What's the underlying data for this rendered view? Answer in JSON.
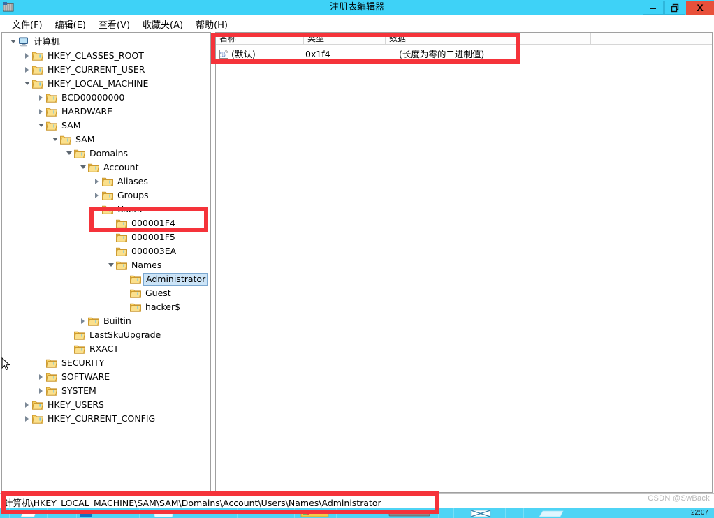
{
  "window": {
    "title": "注册表编辑器",
    "icon": "registry-editor-icon",
    "minimize_label": "—",
    "maximize_label": "❐",
    "close_label": "X"
  },
  "menubar": {
    "items": [
      {
        "label": "文件(F)",
        "name": "menu-file"
      },
      {
        "label": "编辑(E)",
        "name": "menu-edit"
      },
      {
        "label": "查看(V)",
        "name": "menu-view"
      },
      {
        "label": "收藏夹(A)",
        "name": "menu-favorites"
      },
      {
        "label": "帮助(H)",
        "name": "menu-help"
      }
    ]
  },
  "tree": {
    "root_label": "计算机",
    "nodes": [
      {
        "label": "计算机",
        "depth": 0,
        "state": "expanded",
        "icon": "computer-icon",
        "selected": false
      },
      {
        "label": "HKEY_CLASSES_ROOT",
        "depth": 1,
        "state": "collapsed",
        "icon": "folder-icon",
        "selected": false
      },
      {
        "label": "HKEY_CURRENT_USER",
        "depth": 1,
        "state": "collapsed",
        "icon": "folder-icon",
        "selected": false
      },
      {
        "label": "HKEY_LOCAL_MACHINE",
        "depth": 1,
        "state": "expanded",
        "icon": "folder-icon",
        "selected": false
      },
      {
        "label": "BCD00000000",
        "depth": 2,
        "state": "collapsed",
        "icon": "folder-icon",
        "selected": false
      },
      {
        "label": "HARDWARE",
        "depth": 2,
        "state": "collapsed",
        "icon": "folder-icon",
        "selected": false
      },
      {
        "label": "SAM",
        "depth": 2,
        "state": "expanded",
        "icon": "folder-icon",
        "selected": false
      },
      {
        "label": "SAM",
        "depth": 3,
        "state": "expanded",
        "icon": "folder-icon",
        "selected": false
      },
      {
        "label": "Domains",
        "depth": 4,
        "state": "expanded",
        "icon": "folder-icon",
        "selected": false
      },
      {
        "label": "Account",
        "depth": 5,
        "state": "expanded",
        "icon": "folder-icon",
        "selected": false
      },
      {
        "label": "Aliases",
        "depth": 6,
        "state": "collapsed",
        "icon": "folder-icon",
        "selected": false
      },
      {
        "label": "Groups",
        "depth": 6,
        "state": "collapsed",
        "icon": "folder-icon",
        "selected": false
      },
      {
        "label": "Users",
        "depth": 6,
        "state": "expanded",
        "icon": "folder-icon",
        "selected": false
      },
      {
        "label": "000001F4",
        "depth": 7,
        "state": "leaf",
        "icon": "folder-icon",
        "selected": false
      },
      {
        "label": "000001F5",
        "depth": 7,
        "state": "leaf",
        "icon": "folder-icon",
        "selected": false
      },
      {
        "label": "000003EA",
        "depth": 7,
        "state": "leaf",
        "icon": "folder-icon",
        "selected": false
      },
      {
        "label": "Names",
        "depth": 7,
        "state": "expanded",
        "icon": "folder-icon",
        "selected": false
      },
      {
        "label": "Administrator",
        "depth": 8,
        "state": "leaf",
        "icon": "folder-icon",
        "selected": true
      },
      {
        "label": "Guest",
        "depth": 8,
        "state": "leaf",
        "icon": "folder-icon",
        "selected": false
      },
      {
        "label": "hacker$",
        "depth": 8,
        "state": "leaf",
        "icon": "folder-icon",
        "selected": false
      },
      {
        "label": "Builtin",
        "depth": 5,
        "state": "collapsed",
        "icon": "folder-icon",
        "selected": false
      },
      {
        "label": "LastSkuUpgrade",
        "depth": 4,
        "state": "leaf",
        "icon": "folder-icon",
        "selected": false
      },
      {
        "label": "RXACT",
        "depth": 4,
        "state": "leaf",
        "icon": "folder-icon",
        "selected": false
      },
      {
        "label": "SECURITY",
        "depth": 2,
        "state": "leaf",
        "icon": "folder-icon",
        "selected": false
      },
      {
        "label": "SOFTWARE",
        "depth": 2,
        "state": "collapsed",
        "icon": "folder-icon",
        "selected": false
      },
      {
        "label": "SYSTEM",
        "depth": 2,
        "state": "collapsed",
        "icon": "folder-icon",
        "selected": false
      },
      {
        "label": "HKEY_USERS",
        "depth": 1,
        "state": "collapsed",
        "icon": "folder-icon",
        "selected": false
      },
      {
        "label": "HKEY_CURRENT_CONFIG",
        "depth": 1,
        "state": "collapsed",
        "icon": "folder-icon",
        "selected": false
      }
    ]
  },
  "value_list": {
    "columns": [
      "名称",
      "类型",
      "数据"
    ],
    "rows": [
      {
        "icon": "binary-value-icon",
        "name": "(默认)",
        "type": "0x1f4",
        "data": "(长度为零的二进制值)"
      }
    ]
  },
  "statusbar": {
    "path": "计算机\\HKEY_LOCAL_MACHINE\\SAM\\SAM\\Domains\\Account\\Users\\Names\\Administrator",
    "watermark": "CSDN @SwBack"
  },
  "taskbar": {
    "clock": "22:07"
  },
  "annotations": {
    "accent_color": "#f5333a",
    "boxes": [
      {
        "name": "value-row-highlight",
        "target": "default-value-row"
      },
      {
        "name": "key-000001F4-highlight",
        "target": "tree-node-000001F4"
      },
      {
        "name": "path-highlight",
        "target": "status-path"
      }
    ]
  },
  "colors": {
    "titlebar": "#3ed2f7",
    "close_button": "#e8503a",
    "selection": "#cce4f7",
    "taskbar": "#4fd4f5",
    "annotation": "#f5333a"
  }
}
